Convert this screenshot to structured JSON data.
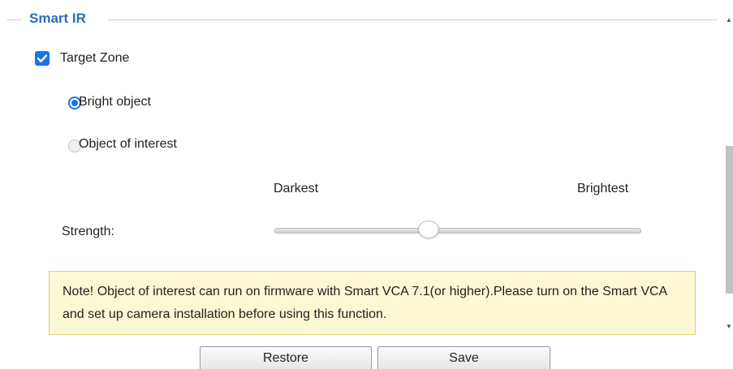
{
  "section": {
    "title": "Smart IR"
  },
  "target_zone": {
    "label": "Target Zone",
    "checked": true
  },
  "mode": {
    "options": [
      {
        "label": "Bright object",
        "selected": true
      },
      {
        "label": "Object of interest",
        "selected": false
      }
    ]
  },
  "strength": {
    "label": "Strength:",
    "min_label": "Darkest",
    "max_label": "Brightest",
    "value_fraction": 0.42
  },
  "note": {
    "text": "Note! Object of interest can run on firmware with Smart VCA 7.1(or higher).Please turn on the Smart VCA and set up camera installation before using this function."
  },
  "buttons": {
    "restore_label": "Restore",
    "save_label": "Save"
  },
  "colors": {
    "accent": "#1a73e8",
    "section_title": "#2a6ebb",
    "note_background": "#fdf8d4",
    "note_border": "#e2cf7a"
  },
  "icons": {
    "checkbox": "checkmark-icon",
    "scroll_up": "chevron-up-icon",
    "scroll_down": "chevron-down-icon"
  }
}
